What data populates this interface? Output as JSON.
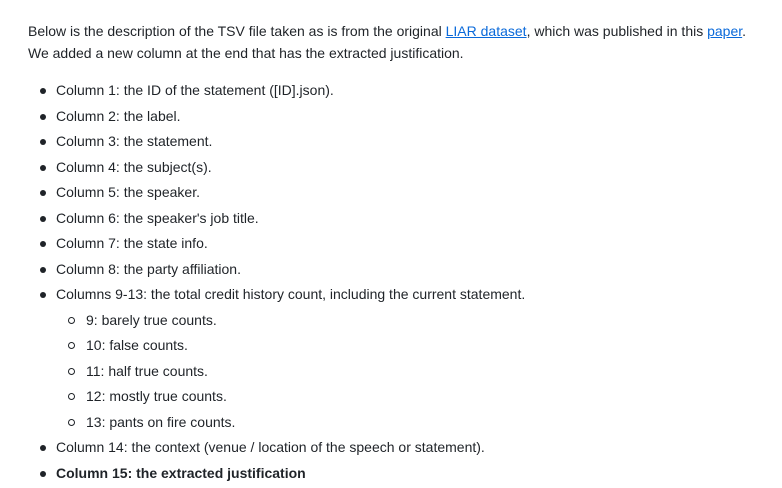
{
  "intro": {
    "line1_before": "Below is the description of the TSV file taken as is from the original ",
    "link1": "LIAR dataset",
    "line1_mid": ", which was published in this ",
    "link2": "paper",
    "line1_end": ".",
    "line2": "We added a new column at the end that has the extracted justification."
  },
  "columns": [
    "Column 1: the ID of the statement ([ID].json).",
    "Column 2: the label.",
    "Column 3: the statement.",
    "Column 4: the subject(s).",
    "Column 5: the speaker.",
    "Column 6: the speaker's job title.",
    "Column 7: the state info.",
    "Column 8: the party affiliation.",
    "Columns 9-13: the total credit history count, including the current statement."
  ],
  "subcolumns": [
    "9: barely true counts.",
    "10: false counts.",
    "11: half true counts.",
    "12: mostly true counts.",
    "13: pants on fire counts."
  ],
  "column14": "Column 14: the context (venue / location of the speech or statement).",
  "column15": "Column 15: the extracted justification"
}
